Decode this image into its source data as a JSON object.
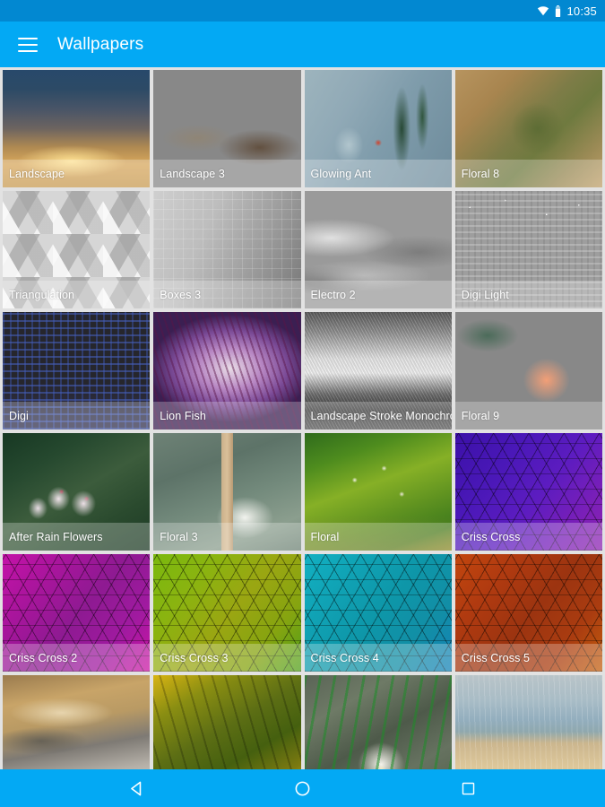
{
  "status_bar": {
    "time": "10:35",
    "icons": [
      "wifi-icon",
      "battery-icon"
    ],
    "background_color": "#0288D1"
  },
  "app_bar": {
    "menu_icon": "hamburger-menu-icon",
    "title": "Wallpapers",
    "background_color": "#03A9F4",
    "text_color": "#FFFFFF"
  },
  "grid": {
    "columns": 4,
    "tiles": [
      {
        "label": "Landscape",
        "art": "a-landscape",
        "label_visible": true
      },
      {
        "label": "Landscape 3",
        "art": "a-landscape3",
        "label_visible": true
      },
      {
        "label": "Glowing Ant",
        "art": "a-glowingant",
        "label_visible": true
      },
      {
        "label": "Floral 8",
        "art": "a-floral8",
        "label_visible": true
      },
      {
        "label": "Triangulation",
        "art": "a-triangulation",
        "label_visible": true
      },
      {
        "label": "Boxes 3",
        "art": "a-boxes3",
        "label_visible": true
      },
      {
        "label": "Electro 2",
        "art": "a-electro2",
        "label_visible": true
      },
      {
        "label": "Digi Light",
        "art": "a-digilight",
        "label_visible": true
      },
      {
        "label": "Digi",
        "art": "a-digi",
        "label_visible": true
      },
      {
        "label": "Lion Fish",
        "art": "a-lionfish",
        "label_visible": true
      },
      {
        "label": "Landscape Stroke Monochrome",
        "art": "a-lsmono",
        "label_visible": true
      },
      {
        "label": "Floral 9",
        "art": "a-floral9",
        "label_visible": true
      },
      {
        "label": "After Rain Flowers",
        "art": "a-afterrain",
        "label_visible": true
      },
      {
        "label": "Floral 3",
        "art": "a-floral3",
        "label_visible": true
      },
      {
        "label": "Floral",
        "art": "a-floral",
        "label_visible": true
      },
      {
        "label": "Criss Cross",
        "art": "cc a-cc1",
        "label_visible": true
      },
      {
        "label": "Criss Cross 2",
        "art": "cc a-cc2",
        "label_visible": true
      },
      {
        "label": "Criss Cross 3",
        "art": "cc a-cc3",
        "label_visible": true
      },
      {
        "label": "Criss Cross 4",
        "art": "cc a-cc4",
        "label_visible": true
      },
      {
        "label": "Criss Cross 5",
        "art": "cc a-cc5",
        "label_visible": true
      },
      {
        "label": "",
        "art": "a-clouds",
        "label_visible": false
      },
      {
        "label": "",
        "art": "a-leaves",
        "label_visible": false
      },
      {
        "label": "",
        "art": "a-whiteflower",
        "label_visible": false
      },
      {
        "label": "",
        "art": "a-beach",
        "label_visible": false
      }
    ]
  },
  "nav_bar": {
    "background_color": "#03A9F4",
    "buttons": [
      {
        "name": "back-button",
        "icon": "triangle-left-icon"
      },
      {
        "name": "home-button",
        "icon": "circle-icon"
      },
      {
        "name": "recents-button",
        "icon": "square-icon"
      }
    ]
  }
}
